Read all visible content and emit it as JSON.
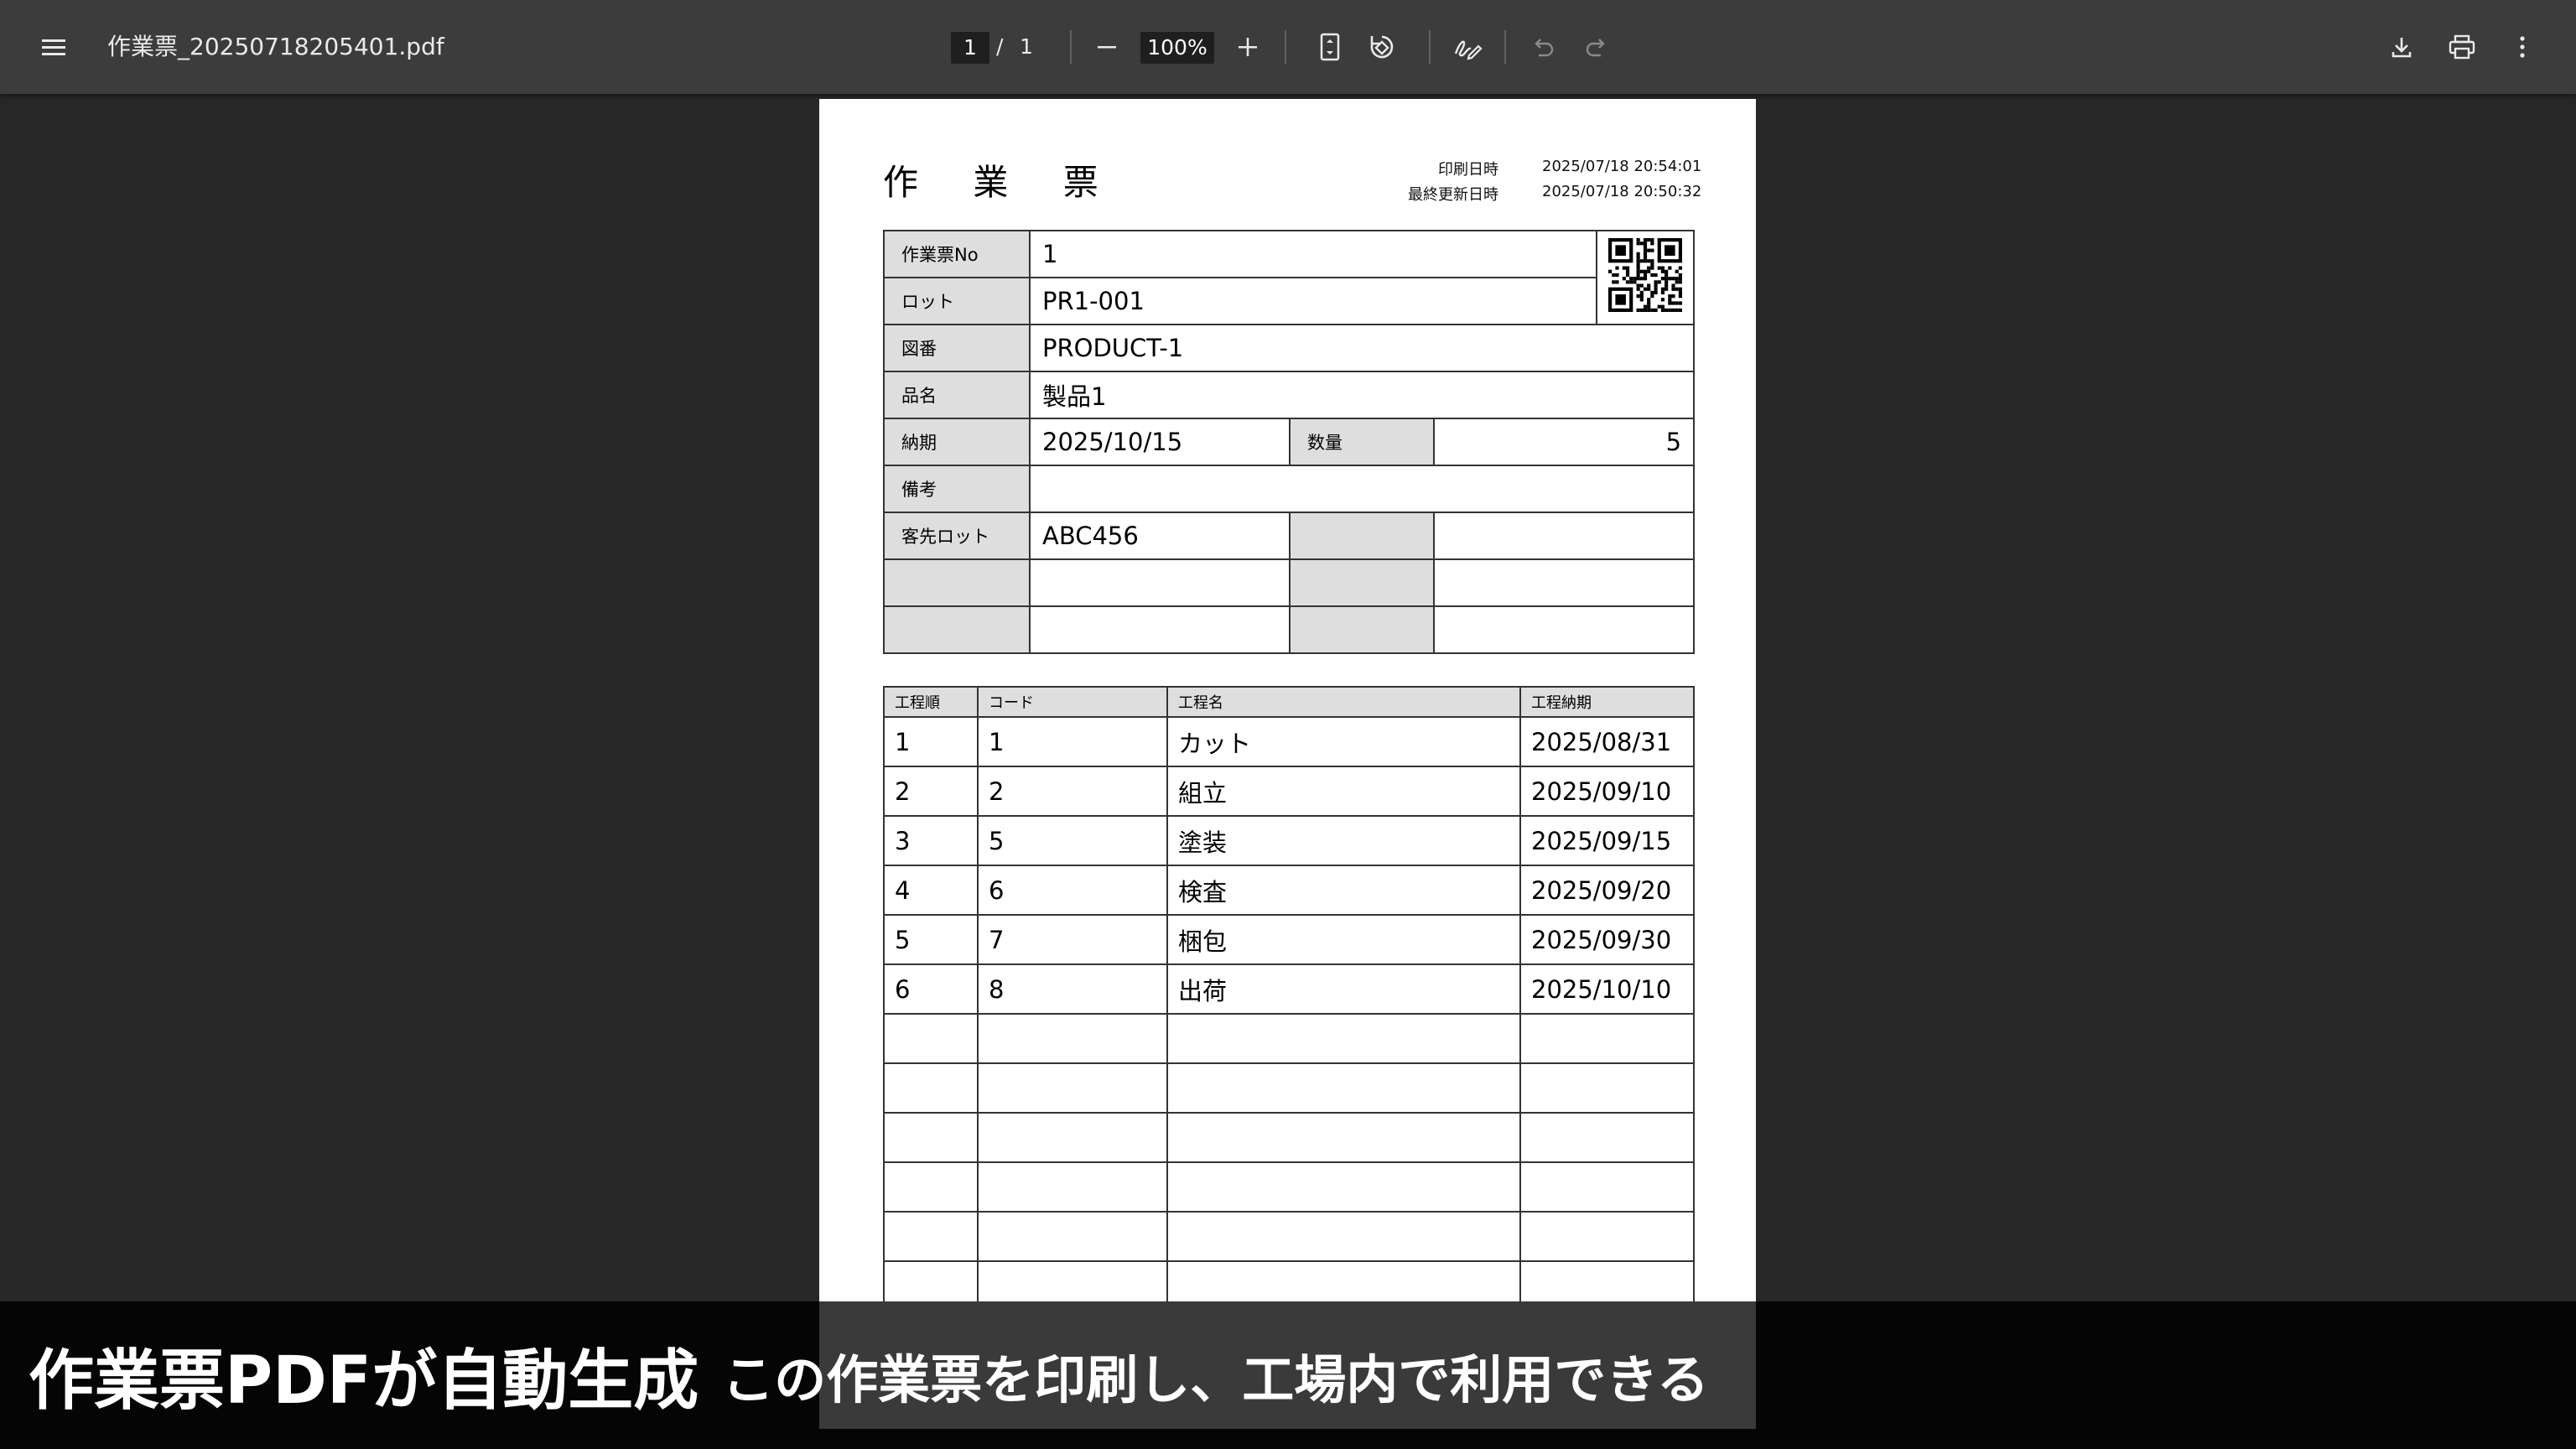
{
  "toolbar": {
    "filename": "作業票_20250718205401.pdf",
    "page_current": "1",
    "page_separator": "/",
    "page_total": "1",
    "zoom": "100%"
  },
  "document": {
    "title": "作 業 票",
    "print_datetime_label": "印刷日時",
    "print_datetime": "2025/07/18 20:54:01",
    "updated_datetime_label": "最終更新日時",
    "updated_datetime": "2025/07/18 20:50:32",
    "info": {
      "no_label": "作業票No",
      "no_value": "1",
      "lot_label": "ロット",
      "lot_value": "PR1-001",
      "drawing_label": "図番",
      "drawing_value": "PRODUCT-1",
      "name_label": "品名",
      "name_value": "製品1",
      "due_label": "納期",
      "due_value": "2025/10/15",
      "qty_label": "数量",
      "qty_value": "5",
      "note_label": "備考",
      "note_value": "",
      "customer_lot_label": "客先ロット",
      "customer_lot_value": "ABC456"
    },
    "process_headers": [
      "工程順",
      "コード",
      "工程名",
      "工程納期"
    ],
    "processes": [
      [
        "1",
        "1",
        "カット",
        "2025/08/31"
      ],
      [
        "2",
        "2",
        "組立",
        "2025/09/10"
      ],
      [
        "3",
        "5",
        "塗装",
        "2025/09/15"
      ],
      [
        "4",
        "6",
        "検査",
        "2025/09/20"
      ],
      [
        "5",
        "7",
        "梱包",
        "2025/09/30"
      ],
      [
        "6",
        "8",
        "出荷",
        "2025/10/10"
      ]
    ]
  },
  "caption": {
    "main": "作業票PDFが自動生成",
    "sub": "この作業票を印刷し、工場内で利用できる"
  },
  "colors": {
    "toolbar_bg": "#3c3c3c",
    "viewer_bg": "#282828",
    "label_cell_bg": "#dedede"
  }
}
